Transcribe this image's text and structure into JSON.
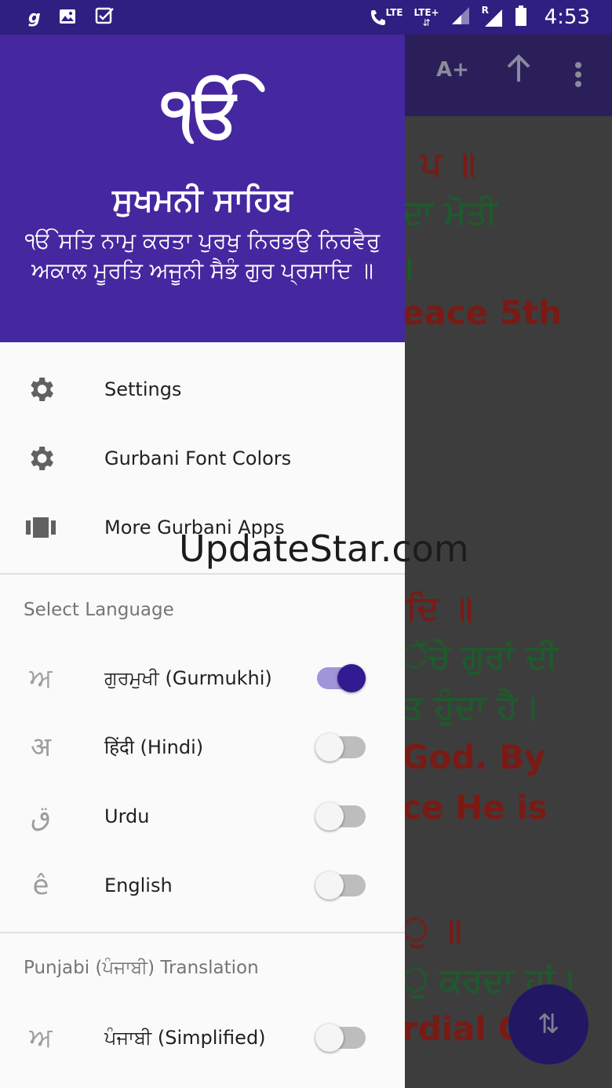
{
  "status_bar": {
    "left_icons": [
      "g-notification-icon",
      "image-icon",
      "checkbox-icon"
    ],
    "network_lte_1": "LTE",
    "network_lte_2": "LTE+",
    "roaming": "R",
    "time": "4:53"
  },
  "app_behind": {
    "toolbar": {
      "font_size_label": "A+"
    },
    "text_fragments": [
      "ਪ ॥",
      "ਦਾ ਮੋਤੀ",
      "।",
      "eace 5th",
      "ਦਿ ॥",
      "ੱਚੇ ਗੁਰਾਂ ਦੀ",
      "ਤ ਹੁੰਦਾ ਹੈ।",
      "God. By",
      "ce He is",
      "ੁ ॥",
      "ੁ ਕਰਦਾ ਹਾਂ।",
      "rdial G"
    ]
  },
  "drawer": {
    "header": {
      "ik_onkar": "ੴ",
      "title": "ਸੁਖਮਨੀ ਸਾਹਿਬ",
      "subtitle": "ੴ ਸਤਿ ਨਾਮੁ ਕਰਤਾ ਪੁਰਖੁ ਨਿਰਭਉ ਨਿਰਵੈਰੁ ਅਕਾਲ ਮੂਰਤਿ ਅਜੂਨੀ ਸੈਭੰ ਗੁਰ ਪ੍ਰਸਾਦਿ ॥"
    },
    "menu": [
      {
        "label": "Settings",
        "icon": "gear-icon"
      },
      {
        "label": "Gurbani Font Colors",
        "icon": "gear-icon"
      },
      {
        "label": "More Gurbani Apps",
        "icon": "view-carousel-icon"
      }
    ],
    "select_language": {
      "title": "Select Language",
      "items": [
        {
          "glyph": "ਅ",
          "label": "ਗੁਰਮੁਖੀ (Gurmukhi)",
          "enabled": true
        },
        {
          "glyph": "अ",
          "label": "हिंदी (Hindi)",
          "enabled": false
        },
        {
          "glyph": "ق",
          "label": "Urdu",
          "enabled": false
        },
        {
          "glyph": "ê",
          "label": "English",
          "enabled": false
        }
      ]
    },
    "punjabi_translation": {
      "title": "Punjabi (ਪੰਜਾਬੀ) Translation",
      "items": [
        {
          "glyph": "ਅ",
          "label": "ਪੰਜਾਬੀ (Simplified)",
          "enabled": false
        }
      ]
    }
  },
  "watermark": "UpdateStar.com",
  "colors": {
    "status_bar": "#2f1f80",
    "drawer_header": "#4527a0",
    "accent": "#311b92",
    "switch_track_on": "#9f95d8"
  }
}
